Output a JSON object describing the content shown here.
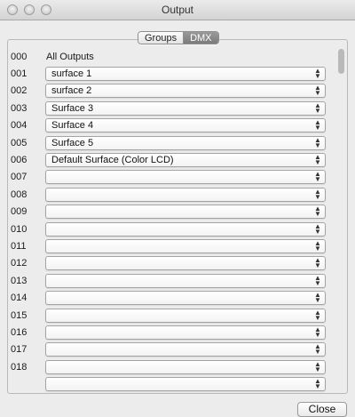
{
  "window": {
    "title": "Output"
  },
  "tabs": [
    {
      "label": "Groups",
      "selected": false
    },
    {
      "label": "DMX",
      "selected": true
    }
  ],
  "header_row": {
    "number": "000",
    "label": "All Outputs"
  },
  "outputs": [
    {
      "number": "001",
      "value": "surface 1"
    },
    {
      "number": "002",
      "value": "surface 2"
    },
    {
      "number": "003",
      "value": "Surface 3"
    },
    {
      "number": "004",
      "value": "Surface 4"
    },
    {
      "number": "005",
      "value": "Surface 5"
    },
    {
      "number": "006",
      "value": "Default Surface (Color LCD)"
    },
    {
      "number": "007",
      "value": ""
    },
    {
      "number": "008",
      "value": ""
    },
    {
      "number": "009",
      "value": ""
    },
    {
      "number": "010",
      "value": ""
    },
    {
      "number": "011",
      "value": ""
    },
    {
      "number": "012",
      "value": ""
    },
    {
      "number": "013",
      "value": ""
    },
    {
      "number": "014",
      "value": ""
    },
    {
      "number": "015",
      "value": ""
    },
    {
      "number": "016",
      "value": ""
    },
    {
      "number": "017",
      "value": ""
    },
    {
      "number": "018",
      "value": ""
    },
    {
      "number": "",
      "value": ""
    }
  ],
  "footer": {
    "close_label": "Close"
  },
  "colors": {
    "window_bg": "#ececec",
    "selected_tab": "#8a8a8a"
  },
  "icons": {
    "dropdown": "up-down-arrows-icon"
  }
}
